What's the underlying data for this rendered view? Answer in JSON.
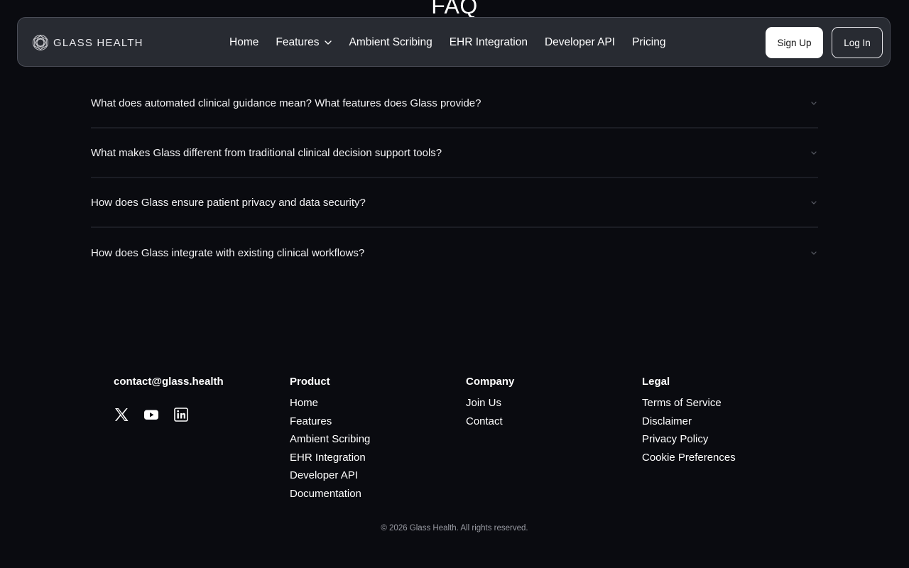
{
  "page": {
    "heading": "FAQ"
  },
  "nav": {
    "brand": "GLASS HEALTH",
    "brand_icon": "glass-health-logo-icon",
    "links": [
      "Home",
      "Features",
      "Ambient Scribing",
      "EHR Integration",
      "Developer API",
      "Pricing"
    ],
    "features_icon": "chevron-down-icon",
    "signup_label": "Sign Up",
    "login_label": "Log In"
  },
  "faq": {
    "items": [
      "What does automated clinical guidance mean? What features does Glass provide?",
      "What makes Glass different from traditional clinical decision support tools?",
      "How does Glass ensure patient privacy and data security?",
      "How does Glass integrate with existing clinical workflows?"
    ],
    "expand_icon": "chevron-down-icon"
  },
  "footer": {
    "email": "contact@glass.health",
    "socials": [
      "x-icon",
      "youtube-icon",
      "linkedin-icon"
    ],
    "product": {
      "title": "Product",
      "links": [
        "Home",
        "Features",
        "Ambient Scribing",
        "EHR Integration",
        "Developer API",
        "Documentation"
      ]
    },
    "company": {
      "title": "Company",
      "links": [
        "Join Us",
        "Contact"
      ]
    },
    "legal": {
      "title": "Legal",
      "links": [
        "Terms of Service",
        "Disclaimer",
        "Privacy Policy",
        "Cookie Preferences"
      ]
    },
    "copyright": "© 2026 Glass Health. All rights reserved."
  },
  "colors": {
    "background": "#0a0b10",
    "nav_background": "#30323a",
    "divider": "#1b1d24",
    "muted_text": "#9a9ca4"
  }
}
